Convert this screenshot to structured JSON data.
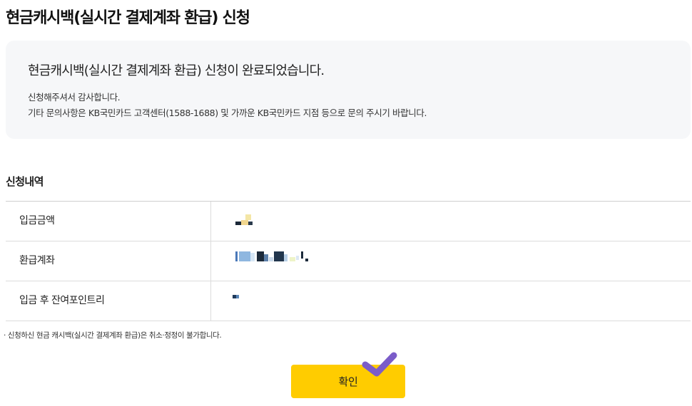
{
  "page": {
    "title": "현금캐시백(실시간 결제계좌 환급) 신청"
  },
  "notice": {
    "title": "현금캐시백(실시간 결제계좌 환급) 신청이 완료되었습니다.",
    "line1": "신청해주셔서 감사합니다.",
    "line2": "기타 문의사항은 KB국민카드 고객센터(1588-1688) 및 가까운 KB국민카드 지점 등으로 문의 주시기 바랍니다."
  },
  "details": {
    "title": "신청내역",
    "rows": [
      {
        "label": "입금금액",
        "value_masked": true
      },
      {
        "label": "환급계좌",
        "value_masked": true
      },
      {
        "label": "입금 후 잔여포인트리",
        "value_masked": true
      }
    ]
  },
  "footnote": "· 신청하신 현금 캐시백(실시간 결제계좌 환급)은 취소·정정이 불가합니다.",
  "confirm_button": {
    "label": "확인"
  },
  "colors": {
    "accent": "#ffcc00",
    "notice_bg": "#f6f7f9",
    "check_mark": "#7b5cc9"
  },
  "icons": {
    "check": "check-icon"
  }
}
